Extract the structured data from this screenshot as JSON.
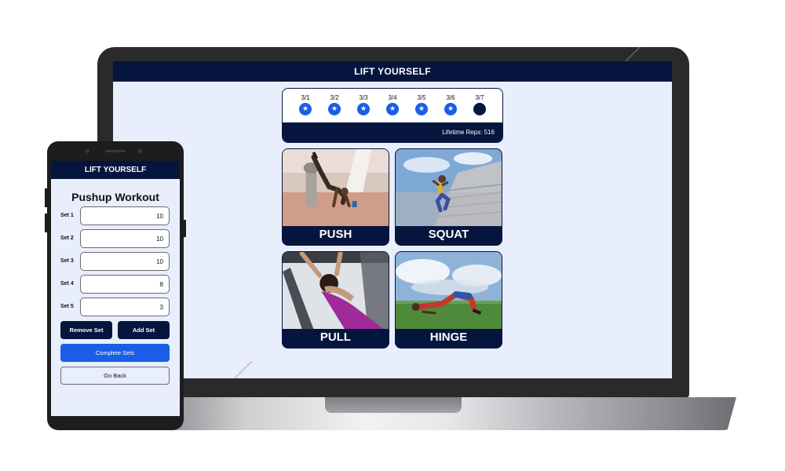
{
  "app_name": "LIFT YOURSELF",
  "colors": {
    "navy": "#06153d",
    "accent_blue": "#1a5ee8",
    "background": "#e8eefb"
  },
  "laptop": {
    "streak": {
      "days": [
        {
          "date": "3/1",
          "status": "completed",
          "icon": "star-icon"
        },
        {
          "date": "3/2",
          "status": "completed",
          "icon": "star-icon"
        },
        {
          "date": "3/3",
          "status": "completed",
          "icon": "star-icon"
        },
        {
          "date": "3/4",
          "status": "completed",
          "icon": "star-icon"
        },
        {
          "date": "3/5",
          "status": "completed",
          "icon": "star-icon"
        },
        {
          "date": "3/6",
          "status": "completed",
          "icon": "star-icon"
        },
        {
          "date": "3/7",
          "status": "pending",
          "icon": ""
        }
      ],
      "lifetime_reps": "Lifetime Reps: 516"
    },
    "tiles": [
      {
        "label": "PUSH",
        "photo": "pushup-photo"
      },
      {
        "label": "SQUAT",
        "photo": "squat-photo"
      },
      {
        "label": "PULL",
        "photo": "pullup-photo"
      },
      {
        "label": "HINGE",
        "photo": "hinge-photo"
      }
    ]
  },
  "phone": {
    "title": "Pushup Workout",
    "sets": [
      {
        "label": "Set 1",
        "value": "10"
      },
      {
        "label": "Set 2",
        "value": "10"
      },
      {
        "label": "Set 3",
        "value": "10"
      },
      {
        "label": "Set 4",
        "value": "8"
      },
      {
        "label": "Set 5",
        "value": "3"
      }
    ],
    "buttons": {
      "remove_set": "Remove Set",
      "add_set": "Add Set",
      "complete_sets": "Complete Sets",
      "go_back": "Go Back"
    }
  }
}
